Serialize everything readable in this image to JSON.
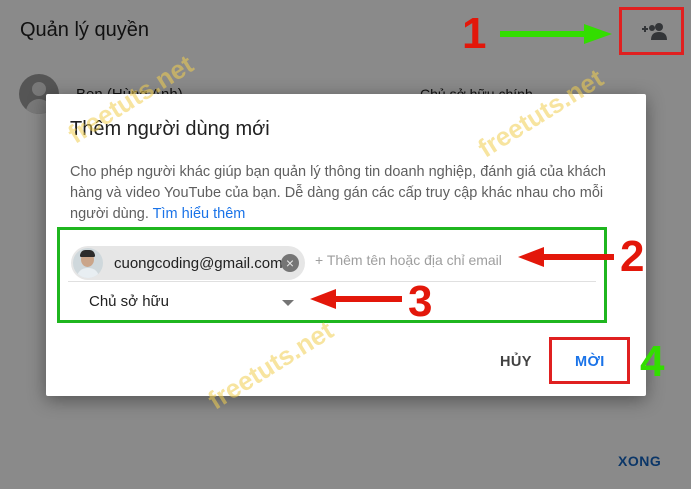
{
  "background": {
    "page_title": "Quản lý quyền",
    "user_name": "Ben (Hùng Anh)",
    "user_role": "Chủ sở hữu chính",
    "add_user_icon": "person-add-icon",
    "done_label": "XONG"
  },
  "dialog": {
    "title": "Thêm người dùng mới",
    "description": "Cho phép người khác giúp bạn quản lý thông tin doanh nghiệp, đánh giá của khách hàng và video YouTube của bạn. Dễ dàng gán các cấp truy cập khác nhau cho mỗi người dùng.",
    "learn_more": "Tìm hiểu thêm",
    "chip_email": "cuongcoding@gmail.com",
    "email_placeholder": "+ Thêm tên hoặc địa chỉ email",
    "role_selected": "Chủ sở hữu",
    "cancel_label": "HỦY",
    "invite_label": "MỜI"
  },
  "annotations": {
    "step_1": "1",
    "step_2": "2",
    "step_3": "3",
    "step_4": "4"
  },
  "watermark": "freetuts.net",
  "colors": {
    "accent": "#1a73e8",
    "annotation_red": "#e3170a",
    "annotation_green": "#33dd00",
    "green_box": "#1fb61f"
  }
}
